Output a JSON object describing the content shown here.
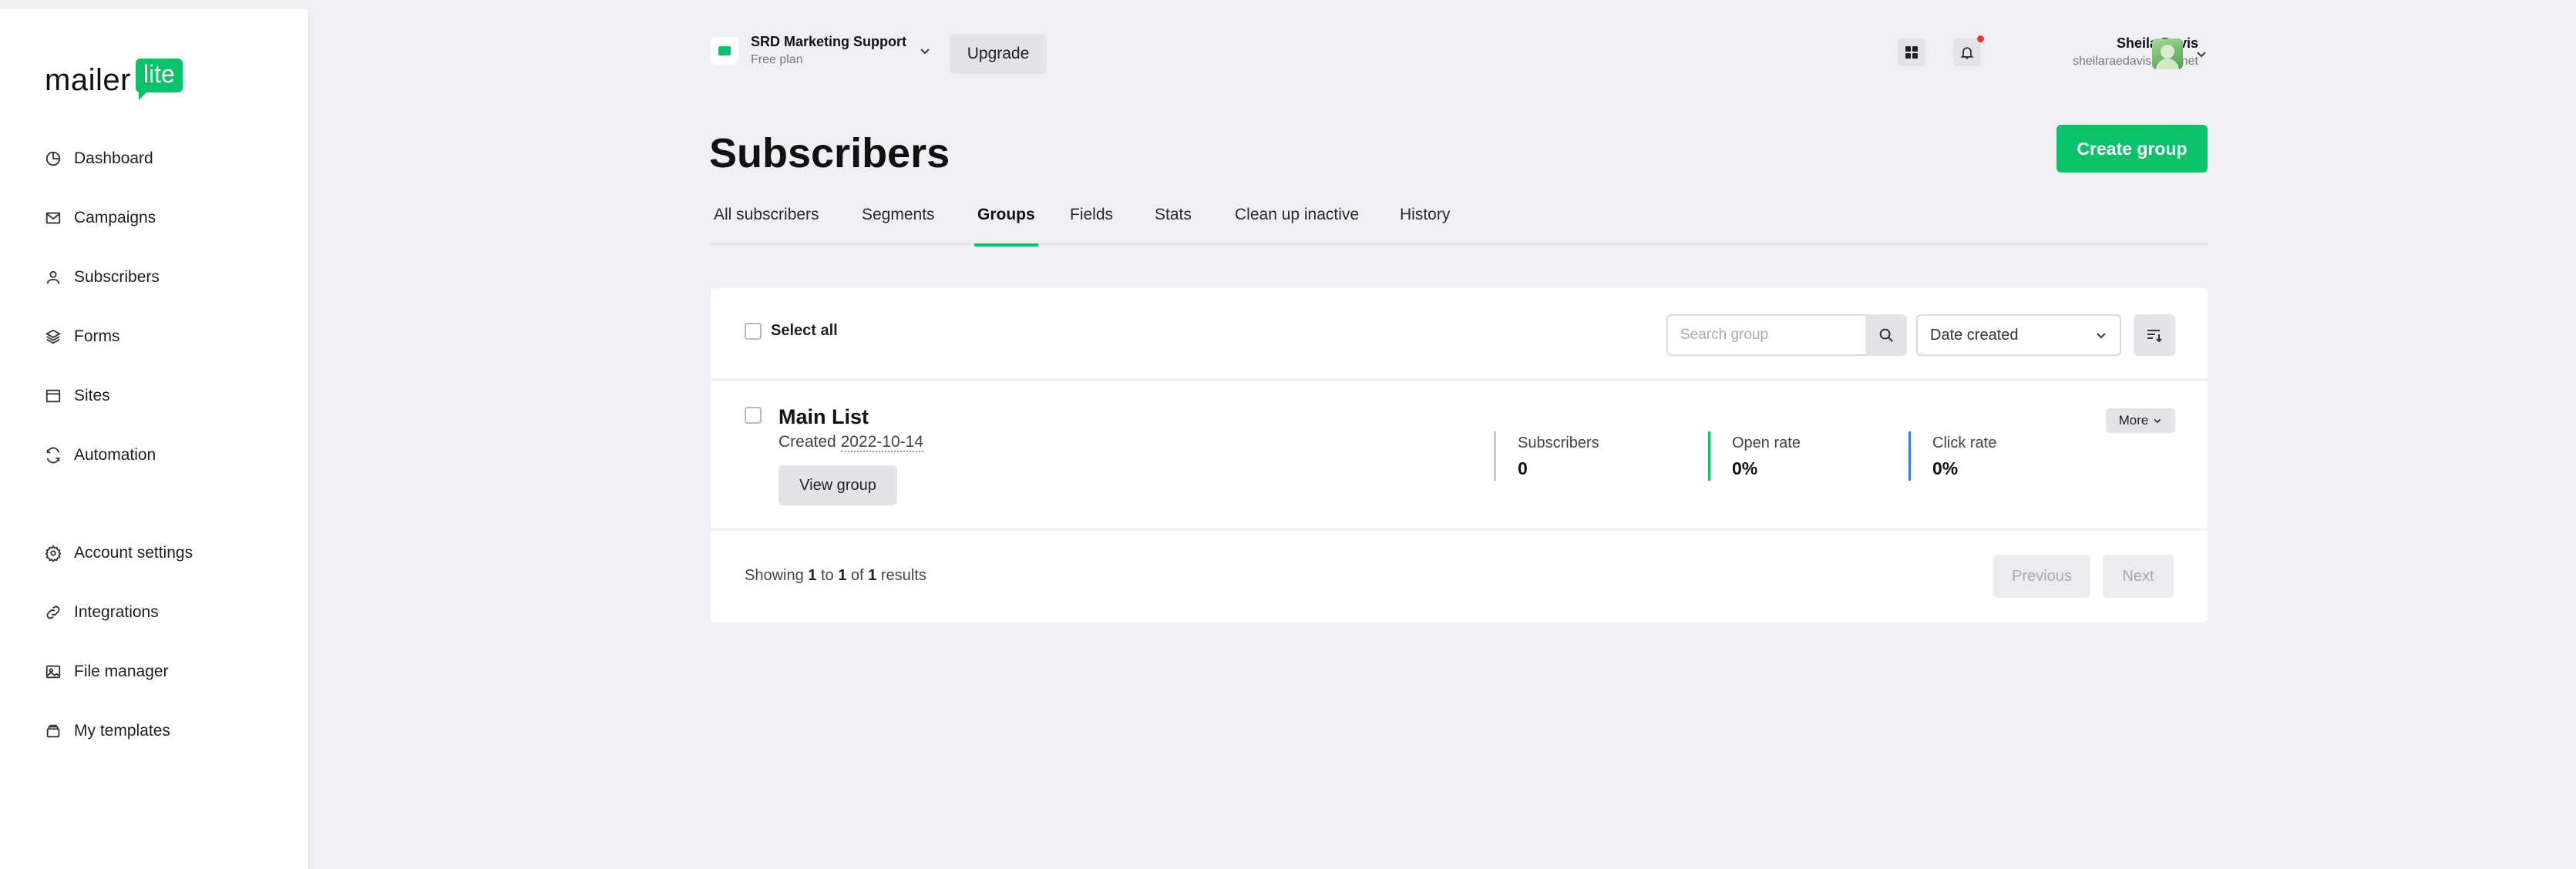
{
  "sidebar": {
    "logo": {
      "part1": "mailer",
      "part2": "lite"
    },
    "items": [
      {
        "label": "Dashboard",
        "icon": "dashboard-icon"
      },
      {
        "label": "Campaigns",
        "icon": "mail-icon"
      },
      {
        "label": "Subscribers",
        "icon": "user-icon"
      },
      {
        "label": "Forms",
        "icon": "layers-icon"
      },
      {
        "label": "Sites",
        "icon": "browser-icon"
      },
      {
        "label": "Automation",
        "icon": "refresh-icon"
      },
      {
        "label": "Account settings",
        "icon": "gear-icon"
      },
      {
        "label": "Integrations",
        "icon": "link-icon"
      },
      {
        "label": "File manager",
        "icon": "image-icon"
      },
      {
        "label": "My templates",
        "icon": "template-icon"
      }
    ]
  },
  "header": {
    "account_name": "SRD Marketing Support",
    "account_plan": "Free plan",
    "upgrade_label": "Upgrade",
    "user_name": "Sheila Davis",
    "user_email": "sheilaraedavis@att.net"
  },
  "page": {
    "title": "Subscribers",
    "create_label": "Create group",
    "tabs": [
      {
        "label": "All subscribers",
        "active": false
      },
      {
        "label": "Segments",
        "active": false
      },
      {
        "label": "Groups",
        "active": true
      },
      {
        "label": "Fields",
        "active": false
      },
      {
        "label": "Stats",
        "active": false
      },
      {
        "label": "Clean up inactive",
        "active": false
      },
      {
        "label": "History",
        "active": false
      }
    ]
  },
  "toolbar": {
    "select_all_label": "Select all",
    "search_placeholder": "Search group",
    "sort_value": "Date created"
  },
  "groups": [
    {
      "name": "Main List",
      "created_prefix": "Created",
      "created_date": "2022-10-14",
      "view_label": "View group",
      "more_label": "More",
      "stats": [
        {
          "label": "Subscribers",
          "value": "0"
        },
        {
          "label": "Open rate",
          "value": "0%"
        },
        {
          "label": "Click rate",
          "value": "0%"
        }
      ]
    }
  ],
  "pagination": {
    "showing_text": "Showing",
    "from": "1",
    "to_text": "to",
    "to": "1",
    "of_text": "of",
    "total": "1",
    "results_text": "results",
    "previous_label": "Previous",
    "next_label": "Next"
  },
  "colors": {
    "accent": "#09c269",
    "background": "#f0f0f4",
    "click_rate": "#3b7fe0",
    "notification": "#e53935"
  }
}
